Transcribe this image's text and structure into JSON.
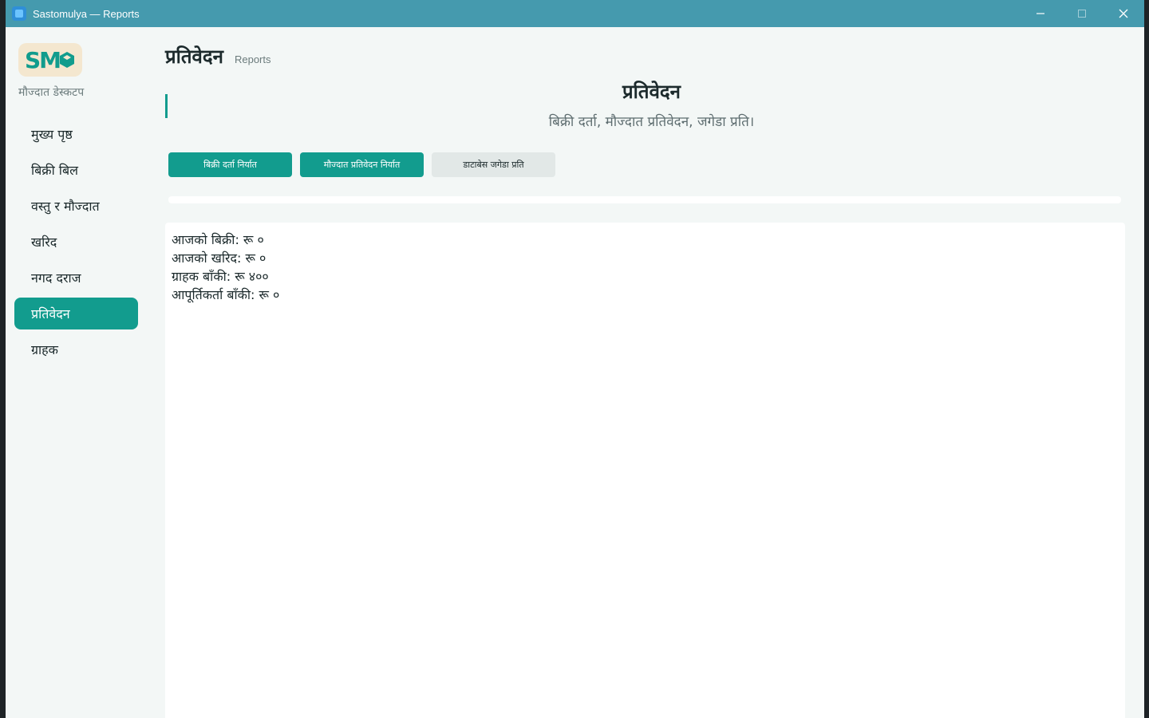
{
  "window": {
    "title": "Sastomulya — Reports",
    "minimize_glyph": "—",
    "maximize_glyph": "☐",
    "close_glyph": "✕"
  },
  "sidebar": {
    "logo_text": "SM",
    "subtitle": "मौज्दात डेस्कटप",
    "items": [
      {
        "label": "मुख्य पृष्ठ"
      },
      {
        "label": "बिक्री बिल"
      },
      {
        "label": "वस्तु र मौज्दात"
      },
      {
        "label": "खरिद"
      },
      {
        "label": "नगद दराज"
      },
      {
        "label": "प्रतिवेदन"
      },
      {
        "label": "ग्राहक"
      }
    ],
    "active_index": 5
  },
  "header": {
    "title": "प्रतिवेदन",
    "subtitle": "Reports"
  },
  "hero": {
    "title": "प्रतिवेदन",
    "subtitle": "बिक्री दर्ता, मौज्दात प्रतिवेदन, जगेडा प्रति।"
  },
  "actions": {
    "export_sales": "बिक्री दर्ता निर्यात",
    "export_stock": "मौज्दात प्रतिवेदन निर्यात",
    "db_backup": "डाटाबेस जगेडा प्रति"
  },
  "summary": {
    "lines": [
      "आजको बिक्री: रू ०",
      "आजको खरिद: रू ०",
      "ग्राहक बाँकी: रू ४००",
      "आपूर्तिकर्ता बाँकी: रू ०"
    ]
  },
  "colors": {
    "titlebar": "#459aae",
    "accent": "#129c8e",
    "background": "#f3f7f6"
  }
}
